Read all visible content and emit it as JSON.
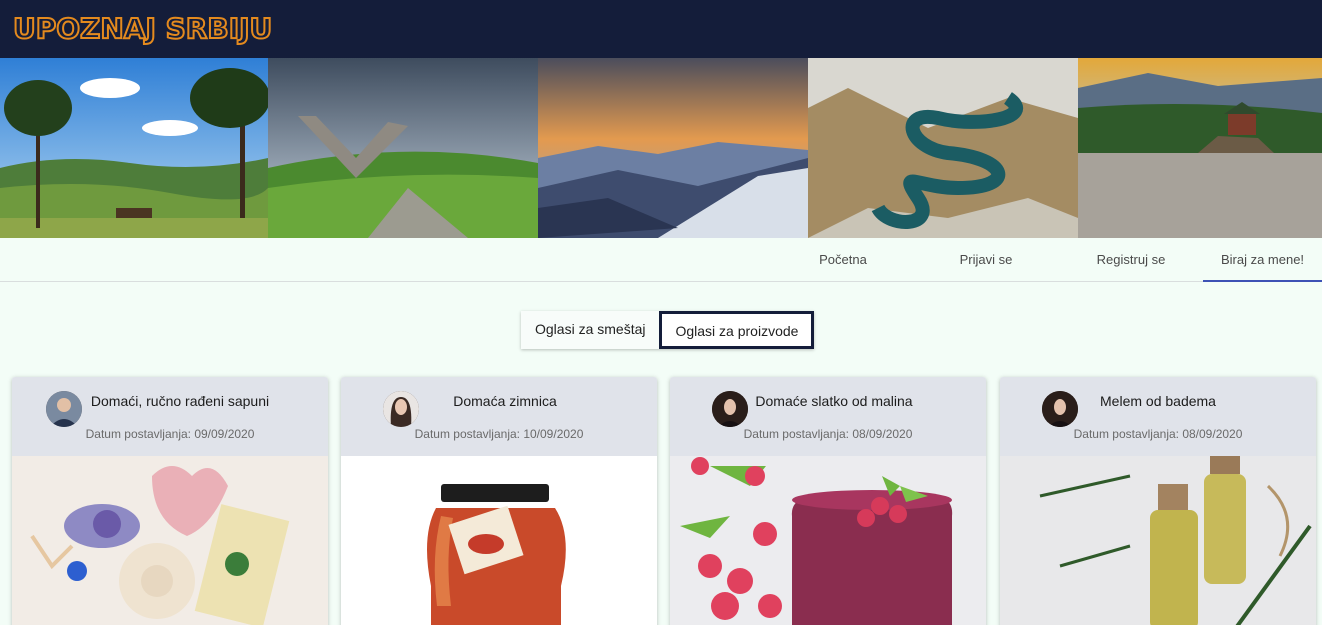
{
  "app": {
    "logo": "UPOZNAJ SRBIJU"
  },
  "banner": {
    "images": [
      "zlatibor-pines-icon",
      "monument-icon",
      "mountain-sunset-icon",
      "river-meanders-icon",
      "river-house-icon"
    ]
  },
  "nav": {
    "items": [
      "Početna",
      "Prijavi se",
      "Registruj se",
      "Biraj za mene!"
    ],
    "active": "Biraj za mene!"
  },
  "toggle": {
    "options": [
      "Oglasi za smeštaj",
      "Oglasi za proizvode"
    ],
    "selected": "Oglasi za proizvode"
  },
  "cards": [
    {
      "title": "Domaći, ručno rađeni sapuni",
      "date": "Datum postavljanja: 09/09/2020"
    },
    {
      "title": "Domaća zimnica",
      "date": "Datum postavljanja: 10/09/2020"
    },
    {
      "title": "Domaće slatko od malina",
      "date": "Datum postavljanja: 08/09/2020"
    },
    {
      "title": "Melem od badema",
      "date": "Datum postavljanja: 08/09/2020"
    }
  ],
  "colors": {
    "header": "#141d3a",
    "logo": "#e48a1e",
    "background": "#f3fdf7",
    "nav_active": "#3d52b5",
    "card_head": "#e0e3ea"
  }
}
